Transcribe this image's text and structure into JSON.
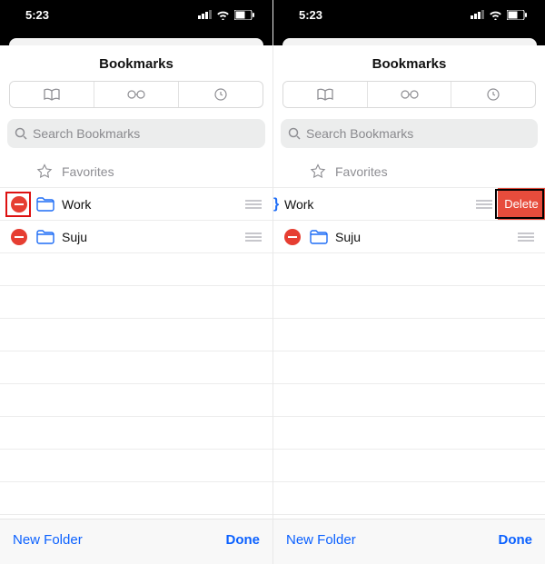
{
  "status": {
    "time": "5:23"
  },
  "title": "Bookmarks",
  "search": {
    "placeholder": "Search Bookmarks"
  },
  "favorites_label": "Favorites",
  "folders": [
    {
      "name": "Work"
    },
    {
      "name": "Suju"
    }
  ],
  "delete_label": "Delete",
  "toolbar": {
    "new_folder": "New Folder",
    "done": "Done"
  }
}
